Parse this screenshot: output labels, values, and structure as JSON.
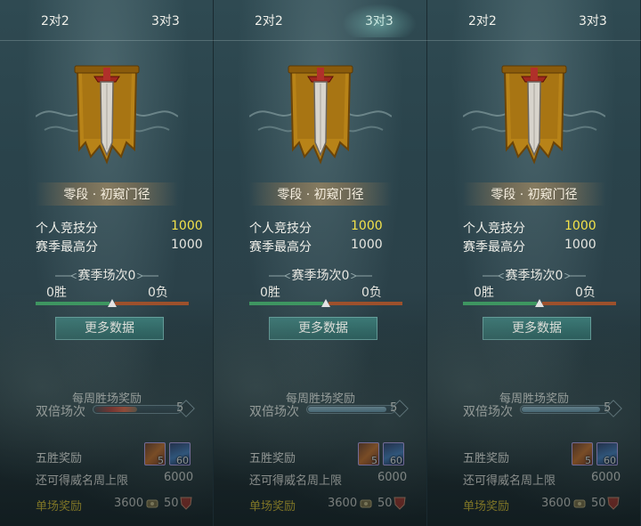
{
  "colors": {
    "highlight_yellow": "#f2e24a",
    "reward_label": "#f0d538",
    "win_green": "#3e9a62",
    "loss_red": "#a0522d",
    "button_teal": "#3f7f7c"
  },
  "panels": [
    {
      "tabs": [
        "2对2",
        "3对3"
      ],
      "active_tab": 0,
      "rank": "零段 · 初窥门径",
      "stats": [
        {
          "label": "个人竞技分",
          "value": "1000",
          "highlight": true
        },
        {
          "label": "赛季最高分",
          "value": "1000",
          "highlight": false
        }
      ],
      "season_title": "赛季场次0",
      "wins": "0胜",
      "losses": "0负",
      "win_ratio": 0.5,
      "more_button": "更多数据",
      "weekly_title": "每周胜场奖励",
      "double_label": "双倍场次",
      "double_count": "5",
      "double_style": "fire",
      "double_fill": 0.5,
      "five_win_label": "五胜奖励",
      "five_win_items": [
        {
          "icon": "orange-scroll-icon",
          "count": "5"
        },
        {
          "icon": "blue-wing-icon",
          "count": "60"
        }
      ],
      "remaining_label": "还可得威名周上限",
      "remaining_value": "6000",
      "single_label": "单场奖励",
      "single_coins": "3600",
      "single_honor": "50"
    },
    {
      "tabs": [
        "2对2",
        "3对3"
      ],
      "active_tab": 1,
      "rank": "零段 · 初窥门径",
      "stats": [
        {
          "label": "个人竞技分",
          "value": "1000",
          "highlight": true
        },
        {
          "label": "赛季最高分",
          "value": "1000",
          "highlight": false
        }
      ],
      "season_title": "赛季场次0",
      "wins": "0胜",
      "losses": "0负",
      "win_ratio": 0.5,
      "more_button": "更多数据",
      "weekly_title": "每周胜场奖励",
      "double_label": "双倍场次",
      "double_count": "5",
      "double_style": "normal",
      "double_fill": 0.92,
      "five_win_label": "五胜奖励",
      "five_win_items": [
        {
          "icon": "orange-scroll-icon",
          "count": "5"
        },
        {
          "icon": "blue-wing-icon",
          "count": "60"
        }
      ],
      "remaining_label": "还可得威名周上限",
      "remaining_value": "6000",
      "single_label": "单场奖励",
      "single_coins": "3600",
      "single_honor": "50"
    },
    {
      "tabs": [
        "2对2",
        "3对3"
      ],
      "active_tab": -1,
      "rank": "零段 · 初窥门径",
      "stats": [
        {
          "label": "个人竞技分",
          "value": "1000",
          "highlight": true
        },
        {
          "label": "赛季最高分",
          "value": "1000",
          "highlight": false
        }
      ],
      "season_title": "赛季场次0",
      "wins": "0胜",
      "losses": "0负",
      "win_ratio": 0.5,
      "more_button": "更多数据",
      "weekly_title": "每周胜场奖励",
      "double_label": "双倍场次",
      "double_count": "5",
      "double_style": "normal",
      "double_fill": 0.92,
      "five_win_label": "五胜奖励",
      "five_win_items": [
        {
          "icon": "orange-scroll-icon",
          "count": "5"
        },
        {
          "icon": "blue-wing-icon",
          "count": "60"
        }
      ],
      "remaining_label": "还可得威名周上限",
      "remaining_value": "6000",
      "single_label": "单场奖励",
      "single_coins": "3600",
      "single_honor": "50"
    }
  ]
}
